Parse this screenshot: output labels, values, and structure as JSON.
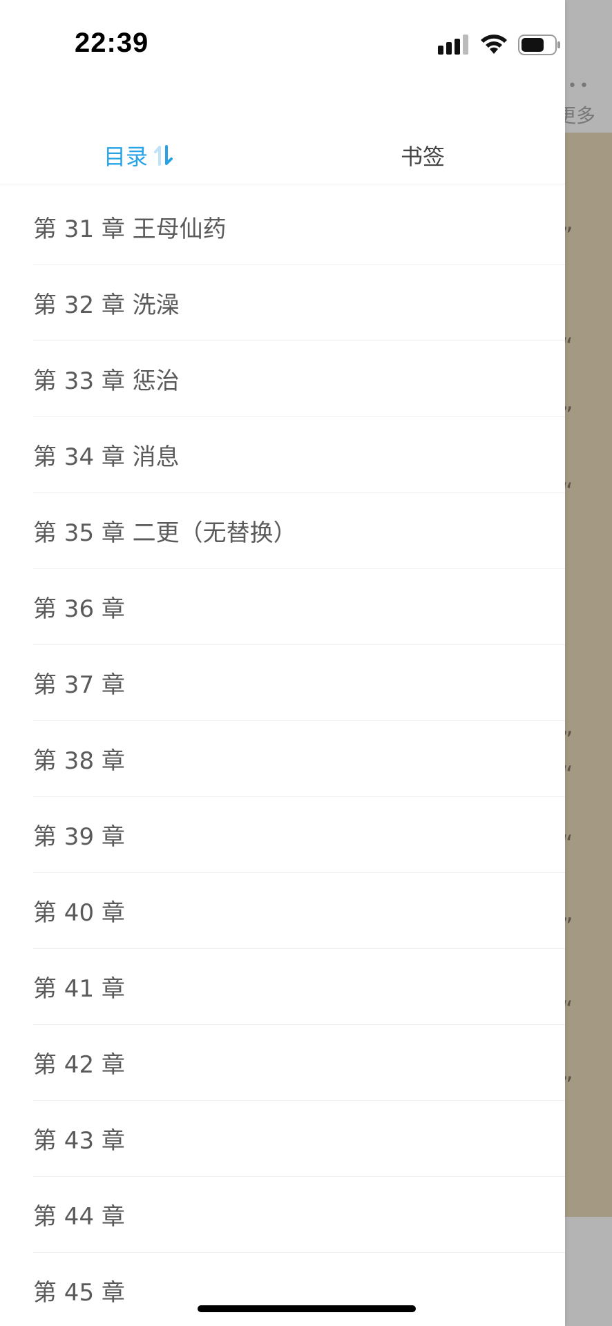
{
  "status_bar": {
    "time": "22:39"
  },
  "background": {
    "more_dots": "••",
    "more_label": "更多",
    "glyphs": [
      "”",
      "“",
      "”",
      "“",
      "”",
      "“",
      "“",
      "”",
      "“",
      "”"
    ]
  },
  "tabs": {
    "toc_label": "目录",
    "bookmark_label": "书签",
    "active_color": "#27a3e6",
    "sort_icon": "sort-toggle-icon"
  },
  "chapters": [
    "第 31 章 王母仙药",
    "第 32 章 洗澡",
    "第 33 章 惩治",
    "第 34 章 消息",
    "第 35 章 二更（无替换）",
    "第 36 章",
    "第 37 章",
    "第 38 章",
    "第 39 章",
    "第 40 章",
    "第 41 章",
    "第 42 章",
    "第 43 章",
    "第 44 章",
    "第 45 章"
  ]
}
